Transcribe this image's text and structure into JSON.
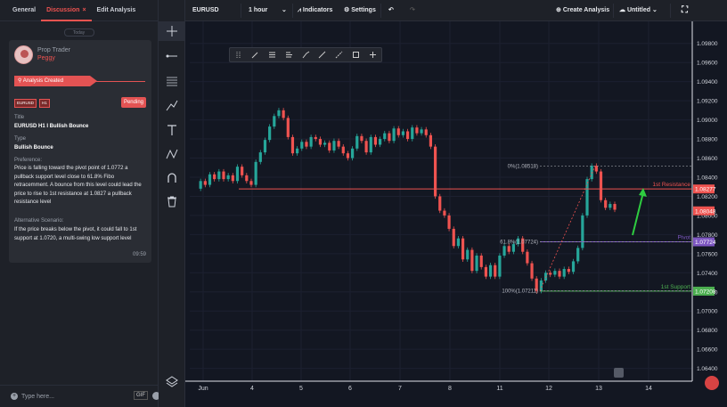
{
  "left_panel": {
    "tabs": [
      "General",
      "Discussion",
      "Edit Analysis"
    ],
    "tab_close": "×",
    "date_separator": "Today",
    "post": {
      "author_role": "Prop Trader",
      "author_name": "Peggy",
      "banner": "Analysis Created",
      "badges": [
        "EURUSD",
        "H1"
      ],
      "status": "Pending",
      "title_label": "Title",
      "title": "EURUSD H1 I Bullish Bounce",
      "type_label": "Type",
      "type": "Bullish Bounce",
      "preference_label": "Preference:",
      "preference": "Price is falling toward the pivot point of 1.0772 a pullback support level close to 61.8% Fibo retracemment. A bounce from this level could lead the price to rise  to 1st resistance at 1.0827 a pullback resistance level",
      "alt_label": "Alternative Scenario:",
      "alt": "If the price breaks below the pivot, it could fall to 1st support at 1.0720, a multi-swing low support level",
      "time": "09:59"
    },
    "input_placeholder": "Type here...",
    "gif_label": "GIF"
  },
  "tools": [
    "crosshair-icon",
    "trend-line-icon",
    "fib-icon",
    "brush-icon",
    "text-icon",
    "pattern-icon",
    "magnet-icon",
    "trash-icon",
    "layers-icon"
  ],
  "topbar": {
    "symbol": "EURUSD",
    "interval": "1 hour",
    "indicators": "Indicators",
    "settings": "Settings",
    "create_analysis": "Create Analysis",
    "layout_name": "Untitled"
  },
  "colors": {
    "resistance": "#ef5350",
    "pivot": "#7e57c2",
    "support": "#4caf50",
    "up_candle": "#26a69a",
    "down_candle": "#ef5350",
    "background": "#131722"
  },
  "chart_data": {
    "type": "candlestick",
    "symbol": "EURUSD",
    "interval": "1 hour",
    "x_ticks": [
      "Jun",
      "4",
      "5",
      "6",
      "7",
      "8",
      "11",
      "12",
      "13",
      "14"
    ],
    "y_ticks": [
      "1.09800",
      "1.09600",
      "1.09400",
      "1.09200",
      "1.09000",
      "1.08800",
      "1.08600",
      "1.08400",
      "1.08200",
      "1.08000",
      "1.07800",
      "1.07600",
      "1.07400",
      "1.07200",
      "1.07000",
      "1.06800",
      "1.06600",
      "1.06400"
    ],
    "ylim": [
      1.0635,
      1.099
    ],
    "levels": [
      {
        "label": "1st Resistance",
        "price": "1.08277",
        "value": 1.08277,
        "color": "#ef5350"
      },
      {
        "label": "Pivot",
        "price": "1.07724",
        "value": 1.07724,
        "color": "#7e57c2"
      },
      {
        "label": "1st Support",
        "price": "1.07208",
        "value": 1.07208,
        "color": "#4caf50"
      }
    ],
    "last_price": {
      "price": "1.08048",
      "value": 1.08048
    },
    "fibonacci": [
      {
        "label": "0%(1.08518)",
        "value": 1.08518
      },
      {
        "label": "61.8%(1.07724)",
        "value": 1.07724
      },
      {
        "label": "100%(1.07211)",
        "value": 1.07211
      }
    ],
    "price_path": [
      1.0828,
      1.0836,
      1.0832,
      1.0843,
      1.0838,
      1.0846,
      1.0838,
      1.0842,
      1.0836,
      1.0851,
      1.0842,
      1.0836,
      1.0832,
      1.0856,
      1.0866,
      1.0879,
      1.0893,
      1.0904,
      1.091,
      1.0902,
      1.0882,
      1.0865,
      1.087,
      1.0877,
      1.0872,
      1.0882,
      1.088,
      1.0874,
      1.0876,
      1.0868,
      1.0878,
      1.0872,
      1.0865,
      1.086,
      1.087,
      1.0883,
      1.0878,
      1.0866,
      1.0882,
      1.0874,
      1.088,
      1.0886,
      1.0878,
      1.0891,
      1.0884,
      1.0888,
      1.088,
      1.0892,
      1.0886,
      1.089,
      1.0884,
      1.0872,
      1.082,
      1.0805,
      1.08,
      1.0786,
      1.0768,
      1.0776,
      1.0754,
      1.0764,
      1.0742,
      1.0758,
      1.0746,
      1.0736,
      1.0748,
      1.0736,
      1.0758,
      1.0768,
      1.0762,
      1.077,
      1.0776,
      1.0762,
      1.075,
      1.0734,
      1.0721,
      1.0732,
      1.074,
      1.0738,
      1.0742,
      1.0736,
      1.0744,
      1.0741,
      1.0752,
      1.0766,
      1.08,
      1.0838,
      1.0852,
      1.0846,
      1.0816,
      1.0808,
      1.0812,
      1.0806
    ],
    "grid": true
  }
}
